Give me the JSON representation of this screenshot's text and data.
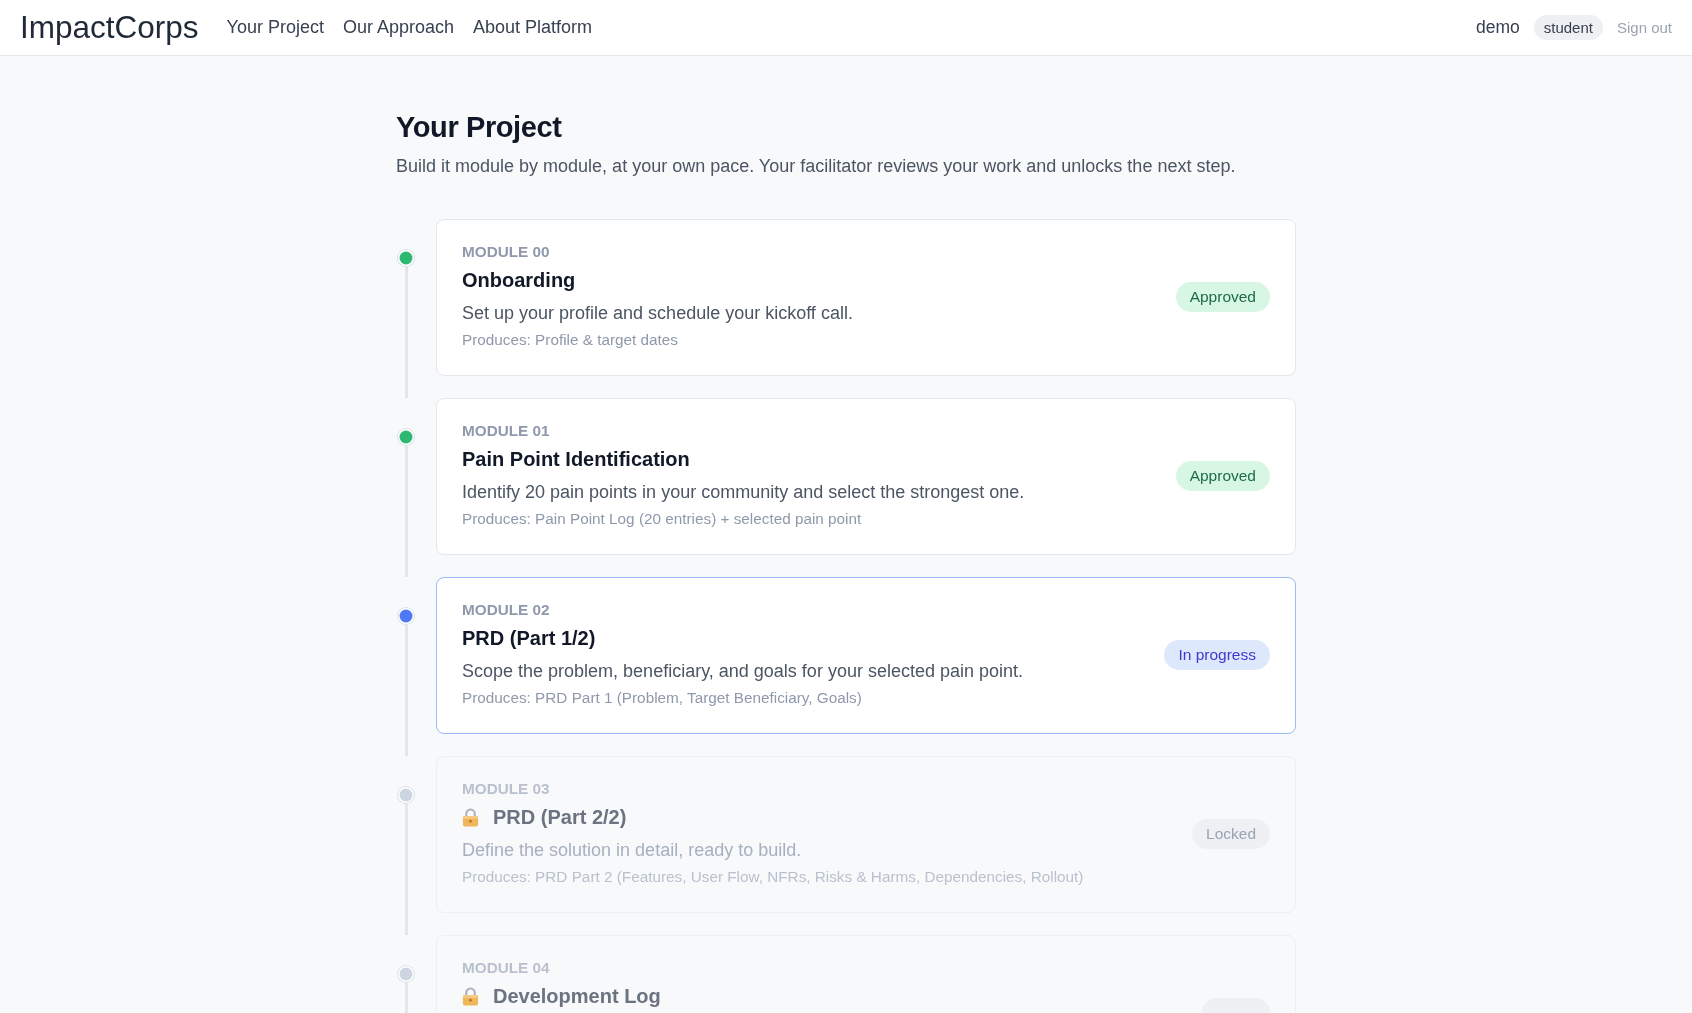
{
  "header": {
    "logo": "ImpactCorps",
    "nav": [
      {
        "label": "Your Project"
      },
      {
        "label": "Our Approach"
      },
      {
        "label": "About Platform"
      }
    ],
    "user": "demo",
    "role": "student",
    "sign_out": "Sign out"
  },
  "page": {
    "title": "Your Project",
    "subtitle": "Build it module by module, at your own pace. Your facilitator reviews your work and unlocks the next step."
  },
  "modules": [
    {
      "kind": "approved",
      "label": "MODULE 00",
      "title": "Onboarding",
      "description": "Set up your profile and schedule your kickoff call.",
      "produces": "Produces: Profile & target dates",
      "badge": "Approved"
    },
    {
      "kind": "approved",
      "label": "MODULE 01",
      "title": "Pain Point Identification",
      "description": "Identify 20 pain points in your community and select the strongest one.",
      "produces": "Produces: Pain Point Log (20 entries) + selected pain point",
      "badge": "Approved"
    },
    {
      "kind": "progress",
      "label": "MODULE 02",
      "title": "PRD (Part 1/2)",
      "description": "Scope the problem, beneficiary, and goals for your selected pain point.",
      "produces": "Produces: PRD Part 1 (Problem, Target Beneficiary, Goals)",
      "badge": "In progress"
    },
    {
      "kind": "locked",
      "label": "MODULE 03",
      "title": "PRD (Part 2/2)",
      "description": "Define the solution in detail, ready to build.",
      "produces": "Produces: PRD Part 2 (Features, User Flow, NFRs, Risks & Harms, Dependencies, Rollout)",
      "badge": "Locked"
    },
    {
      "kind": "locked",
      "label": "MODULE 04",
      "title": "Development Log"
    }
  ]
}
